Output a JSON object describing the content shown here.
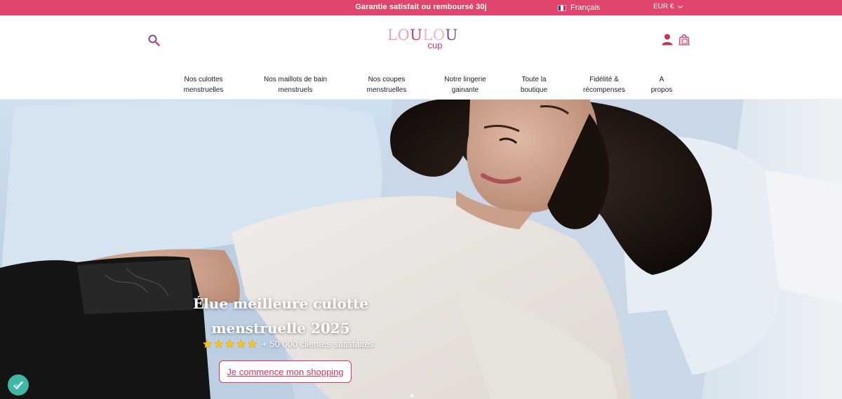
{
  "announcement": {
    "text": "Garantie satisfait ou remboursé 30j"
  },
  "language": {
    "label": "Français",
    "flag_colors": [
      "#1f3ea0",
      "#ffffff",
      "#e02a3a"
    ]
  },
  "currency": {
    "label": "EUR €"
  },
  "header": {
    "logo": {
      "word_parts": [
        "LO",
        "U",
        "LO",
        "U"
      ],
      "sub": "cup"
    },
    "search_icon": "magnifier-icon",
    "account_icon": "user-icon",
    "cart_icon": "shopping-bag-icon"
  },
  "nav": {
    "items": [
      {
        "label": "Nos culottes\nmenstruelles"
      },
      {
        "label": "Nos maillots de bain\nmenstruels"
      },
      {
        "label": "Nos coupes\nmenstruelles"
      },
      {
        "label": "Notre lingerie\ngainante"
      },
      {
        "label": "Toute la\nboutique"
      },
      {
        "label": "Fidélité &\nrécompenses"
      },
      {
        "label": "A\npropos"
      }
    ]
  },
  "hero": {
    "title": "Élue meilleure culotte\nmenstruelle 2025",
    "rating": {
      "stars": 5,
      "text": "+ 50 000 clientes satisfaites"
    },
    "cta_label": "Je commence mon shopping"
  },
  "colors": {
    "brand_pink": "#e0466c",
    "cta_border": "#d4365e",
    "chat_teal": "#3fb6a8",
    "star_gold": "#f5c518"
  }
}
